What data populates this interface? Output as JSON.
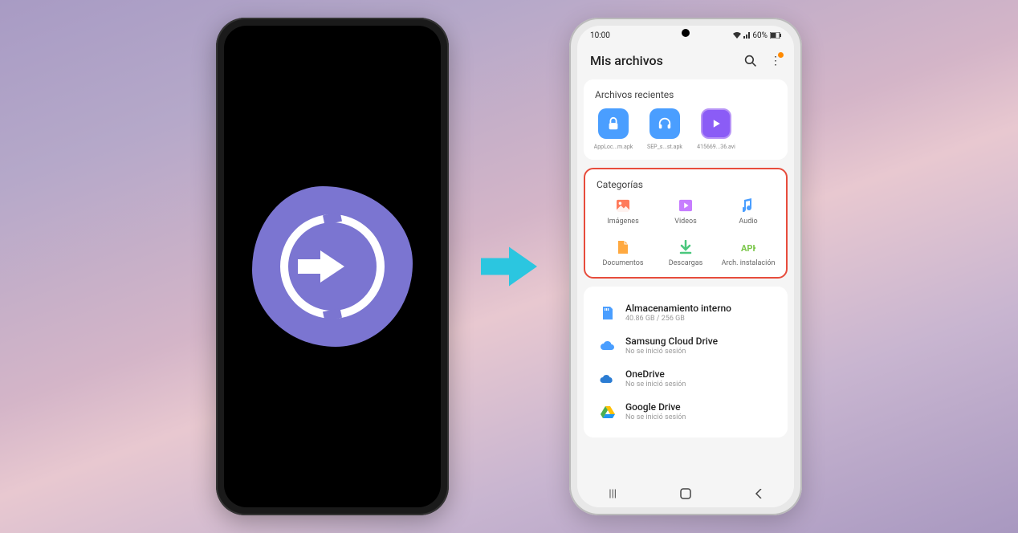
{
  "status": {
    "time": "10:00",
    "battery": "60%"
  },
  "app": {
    "title": "Mis archivos"
  },
  "recent": {
    "title": "Archivos recientes",
    "items": [
      {
        "label": "AppLoc...m.apk",
        "color": "blue",
        "glyph": "lock"
      },
      {
        "label": "SEP_s...st.apk",
        "color": "blue",
        "glyph": "headphones"
      },
      {
        "label": "415669...36.avi",
        "color": "purple",
        "glyph": "play"
      }
    ]
  },
  "categories": {
    "title": "Categorías",
    "items": [
      {
        "label": "Imágenes",
        "name": "images",
        "color": "#ff7b5c"
      },
      {
        "label": "Videos",
        "name": "videos",
        "color": "#c77dff"
      },
      {
        "label": "Audio",
        "name": "audio",
        "color": "#4a9eff"
      },
      {
        "label": "Documentos",
        "name": "documents",
        "color": "#ffa940"
      },
      {
        "label": "Descargas",
        "name": "downloads",
        "color": "#4ac77d"
      },
      {
        "label": "Arch. instalación",
        "name": "apk",
        "color": "#7bc74a"
      }
    ]
  },
  "storage": {
    "items": [
      {
        "label": "Almacenamiento interno",
        "sub": "40.86 GB / 256 GB",
        "icon": "sd",
        "color": "#4a9eff"
      },
      {
        "label": "Samsung Cloud Drive",
        "sub": "No se inició sesión",
        "icon": "cloud",
        "color": "#4a9eff"
      },
      {
        "label": "OneDrive",
        "sub": "No se inició sesión",
        "icon": "onedrive",
        "color": "#2b7cd3"
      },
      {
        "label": "Google Drive",
        "sub": "No se inició sesión",
        "icon": "gdrive",
        "color": "#ffa940"
      }
    ]
  }
}
